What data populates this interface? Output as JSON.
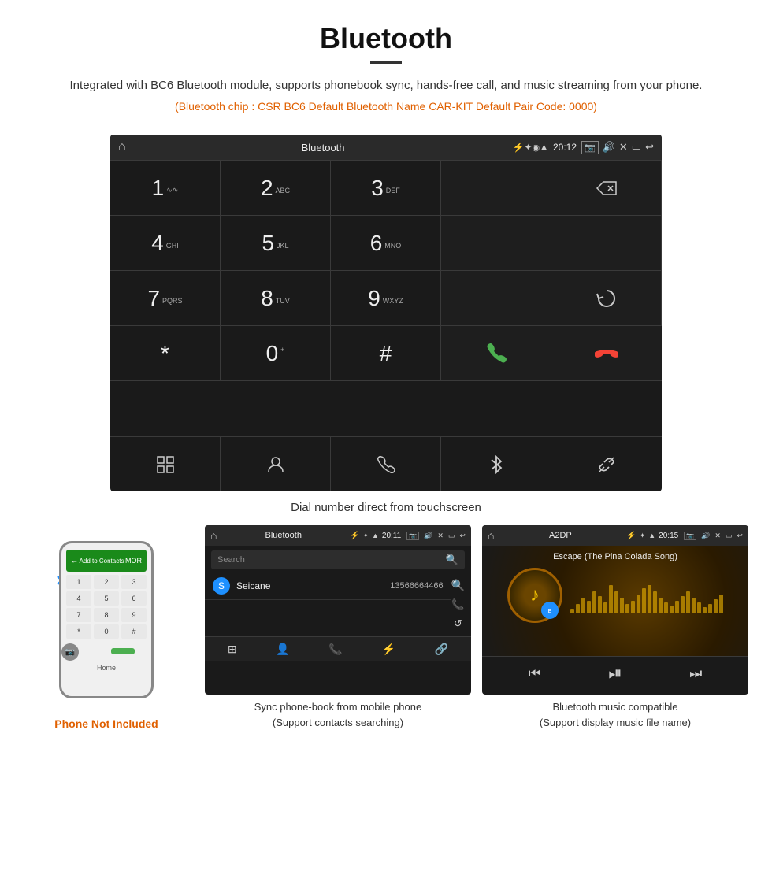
{
  "header": {
    "title": "Bluetooth",
    "subtitle": "Integrated with BC6 Bluetooth module, supports phonebook sync, hands-free call, and music streaming from your phone.",
    "specs": "(Bluetooth chip : CSR BC6    Default Bluetooth Name CAR-KIT    Default Pair Code: 0000)"
  },
  "main_screen": {
    "status_bar": {
      "title": "Bluetooth",
      "time": "20:12",
      "usb_icon": "⚡",
      "home_icon": "⌂"
    },
    "dial_keys": [
      {
        "num": "1",
        "sub": "∿∿"
      },
      {
        "num": "2",
        "sub": "ABC"
      },
      {
        "num": "3",
        "sub": "DEF"
      },
      {
        "num": "",
        "sub": ""
      },
      {
        "num": "",
        "sub": "backspace"
      },
      {
        "num": "4",
        "sub": "GHI"
      },
      {
        "num": "5",
        "sub": "JKL"
      },
      {
        "num": "6",
        "sub": "MNO"
      },
      {
        "num": "",
        "sub": ""
      },
      {
        "num": "",
        "sub": ""
      },
      {
        "num": "7",
        "sub": "PQRS"
      },
      {
        "num": "8",
        "sub": "TUV"
      },
      {
        "num": "9",
        "sub": "WXYZ"
      },
      {
        "num": "",
        "sub": ""
      },
      {
        "num": "",
        "sub": "refresh"
      },
      {
        "num": "*",
        "sub": ""
      },
      {
        "num": "0",
        "sub": "+"
      },
      {
        "num": "#",
        "sub": ""
      },
      {
        "num": "",
        "sub": "call-green"
      },
      {
        "num": "",
        "sub": "call-red"
      }
    ],
    "bottom_icons": [
      "grid",
      "person",
      "phone",
      "bluetooth",
      "link"
    ],
    "caption": "Dial number direct from touchscreen"
  },
  "phone": {
    "not_included_label": "Phone Not Included",
    "bluetooth_symbol": "ʙ"
  },
  "phonebook_screen": {
    "status_bar": {
      "home": "⌂",
      "title": "Bluetooth",
      "usb": "⚡",
      "time": "20:11"
    },
    "search_placeholder": "Search",
    "contact": {
      "initial": "S",
      "name": "Seicane",
      "number": "13566664466"
    },
    "caption_line1": "Sync phone-book from mobile phone",
    "caption_line2": "(Support contacts searching)"
  },
  "music_screen": {
    "status_bar": {
      "home": "⌂",
      "title": "A2DP",
      "usb": "⚡",
      "time": "20:15"
    },
    "track_name": "Escape (The Pina Colada Song)",
    "eq_bars": [
      3,
      6,
      10,
      8,
      14,
      11,
      7,
      18,
      14,
      10,
      6,
      8,
      12,
      16,
      18,
      14,
      10,
      7,
      5,
      8,
      11,
      14,
      10,
      7,
      4,
      6,
      9,
      12
    ],
    "caption_line1": "Bluetooth music compatible",
    "caption_line2": "(Support display music file name)"
  }
}
